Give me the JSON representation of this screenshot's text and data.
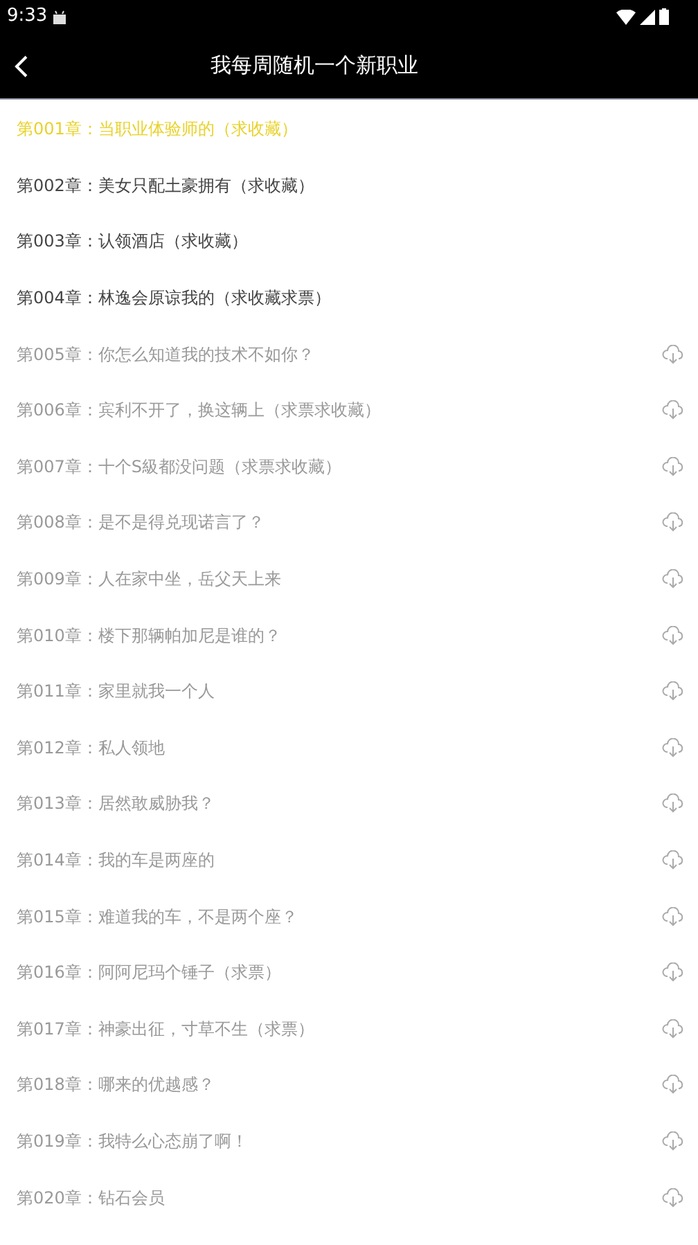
{
  "status_bar": {
    "time": "9:33"
  },
  "toolbar": {
    "title": "我每周随机一个新职业"
  },
  "chapters": [
    {
      "title": "第001章：当职业体验师的（求收藏）",
      "selected": true,
      "downloaded": true
    },
    {
      "title": "第002章：美女只配土豪拥有（求收藏）",
      "selected": false,
      "downloaded": true
    },
    {
      "title": "第003章：认领酒店（求收藏）",
      "selected": false,
      "downloaded": true
    },
    {
      "title": "第004章：林逸会原谅我的（求收藏求票）",
      "selected": false,
      "downloaded": true
    },
    {
      "title": "第005章：你怎么知道我的技术不如你？",
      "selected": false,
      "downloaded": false
    },
    {
      "title": "第006章：宾利不开了，换这辆上（求票求收藏）",
      "selected": false,
      "downloaded": false
    },
    {
      "title": "第007章：十个S級都没问题（求票求收藏）",
      "selected": false,
      "downloaded": false
    },
    {
      "title": "第008章：是不是得兑现诺言了？",
      "selected": false,
      "downloaded": false
    },
    {
      "title": "第009章：人在家中坐，岳父天上来",
      "selected": false,
      "downloaded": false
    },
    {
      "title": "第010章：楼下那辆帕加尼是谁的？",
      "selected": false,
      "downloaded": false
    },
    {
      "title": "第011章：家里就我一个人",
      "selected": false,
      "downloaded": false
    },
    {
      "title": "第012章：私人领地",
      "selected": false,
      "downloaded": false
    },
    {
      "title": "第013章：居然敢威胁我？",
      "selected": false,
      "downloaded": false
    },
    {
      "title": "第014章：我的车是两座的",
      "selected": false,
      "downloaded": false
    },
    {
      "title": "第015章：难道我的车，不是两个座？",
      "selected": false,
      "downloaded": false
    },
    {
      "title": "第016章：阿阿尼玛个锤子（求票）",
      "selected": false,
      "downloaded": false
    },
    {
      "title": "第017章：神豪出征，寸草不生（求票）",
      "selected": false,
      "downloaded": false
    },
    {
      "title": "第018章：哪来的优越感？",
      "selected": false,
      "downloaded": false
    },
    {
      "title": "第019章：我特么心态崩了啊！",
      "selected": false,
      "downloaded": false
    },
    {
      "title": "第020章：钻石会员",
      "selected": false,
      "downloaded": false
    }
  ]
}
